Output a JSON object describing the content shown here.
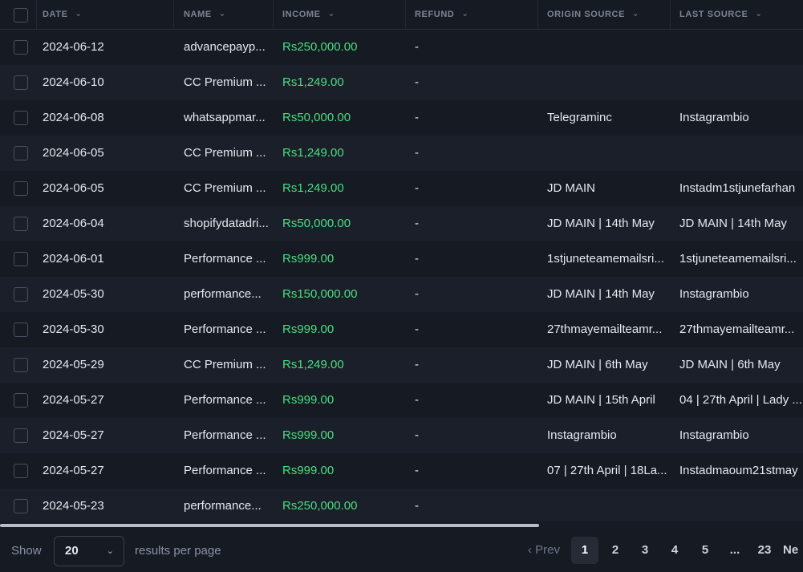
{
  "columns": {
    "date": "DATE",
    "name": "NAME",
    "income": "INCOME",
    "refund": "REFUND",
    "origin_source": "ORIGIN SOURCE",
    "last_source": "LAST SOURCE"
  },
  "icons": {
    "sort": "chevron-down-icon",
    "select": "chevron-down-icon",
    "prev": "chevron-left-icon"
  },
  "colors": {
    "background": "#161a23",
    "row_alt": "#1b1f29",
    "income": "#4ade80"
  },
  "rows": [
    {
      "date": "2024-06-12",
      "name": "advancepayp...",
      "income": "Rs250,000.00",
      "refund": "-",
      "origin": "",
      "last": ""
    },
    {
      "date": "2024-06-10",
      "name": "CC Premium ...",
      "income": "Rs1,249.00",
      "refund": "-",
      "origin": "",
      "last": ""
    },
    {
      "date": "2024-06-08",
      "name": "whatsappmar...",
      "income": "Rs50,000.00",
      "refund": "-",
      "origin": "Telegraminc",
      "last": "Instagrambio"
    },
    {
      "date": "2024-06-05",
      "name": "CC Premium ...",
      "income": "Rs1,249.00",
      "refund": "-",
      "origin": "",
      "last": ""
    },
    {
      "date": "2024-06-05",
      "name": "CC Premium ...",
      "income": "Rs1,249.00",
      "refund": "-",
      "origin": "JD MAIN",
      "last": "Instadm1stjunefarhan"
    },
    {
      "date": "2024-06-04",
      "name": "shopifydatadri...",
      "income": "Rs50,000.00",
      "refund": "-",
      "origin": "JD MAIN | 14th May",
      "last": "JD MAIN | 14th May"
    },
    {
      "date": "2024-06-01",
      "name": "Performance ...",
      "income": "Rs999.00",
      "refund": "-",
      "origin": "1stjuneteamemailsri...",
      "last": "1stjuneteamemailsri..."
    },
    {
      "date": "2024-05-30",
      "name": "performance...",
      "income": "Rs150,000.00",
      "refund": "-",
      "origin": "JD MAIN | 14th May",
      "last": "Instagrambio"
    },
    {
      "date": "2024-05-30",
      "name": "Performance ...",
      "income": "Rs999.00",
      "refund": "-",
      "origin": "27thmayemailteamr...",
      "last": "27thmayemailteamr..."
    },
    {
      "date": "2024-05-29",
      "name": "CC Premium ...",
      "income": "Rs1,249.00",
      "refund": "-",
      "origin": "JD MAIN | 6th May",
      "last": "JD MAIN | 6th May"
    },
    {
      "date": "2024-05-27",
      "name": "Performance ...",
      "income": "Rs999.00",
      "refund": "-",
      "origin": "JD MAIN | 15th April",
      "last": "04 | 27th April | Lady ..."
    },
    {
      "date": "2024-05-27",
      "name": "Performance ...",
      "income": "Rs999.00",
      "refund": "-",
      "origin": "Instagrambio",
      "last": "Instagrambio"
    },
    {
      "date": "2024-05-27",
      "name": "Performance ...",
      "income": "Rs999.00",
      "refund": "-",
      "origin": "07 | 27th April | 18La...",
      "last": "Instadmaoum21stmay"
    },
    {
      "date": "2024-05-23",
      "name": "performance...",
      "income": "Rs250,000.00",
      "refund": "-",
      "origin": "",
      "last": ""
    }
  ],
  "footer": {
    "show_label": "Show",
    "page_size": "20",
    "per_page_label": "results per page",
    "prev_label": "Prev",
    "pages": [
      "1",
      "2",
      "3",
      "4",
      "5",
      "...",
      "23"
    ],
    "current_page": "1",
    "next_label": "Ne"
  }
}
